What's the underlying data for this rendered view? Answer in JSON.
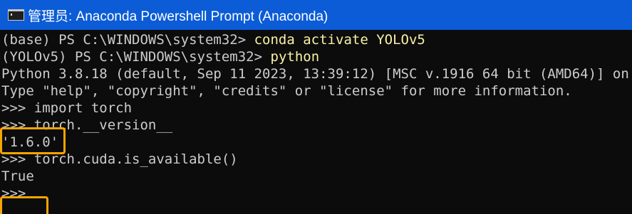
{
  "window": {
    "title": "管理员: Anaconda Powershell Prompt (Anaconda)",
    "icon": "terminal-icon"
  },
  "terminal": {
    "line1": {
      "prompt": "(base) PS C:\\WINDOWS\\system32> ",
      "command": "conda activate YOLOv5"
    },
    "line2": {
      "prompt": "(YOLOv5) PS C:\\WINDOWS\\system32> ",
      "command": "python"
    },
    "line3": "Python 3.8.18 (default, Sep 11 2023, 13:39:12) [MSC v.1916 64 bit (AMD64)] on win32",
    "line4": "Type \"help\", \"copyright\", \"credits\" or \"license\" for more information.",
    "line5": ">>> import torch",
    "line6": ">>> torch.__version__",
    "line7": "'1.6.0'",
    "line8": ">>> torch.cuda.is_available()",
    "line9": "True",
    "line10": ">>> "
  },
  "highlight_color": "#f7a500"
}
